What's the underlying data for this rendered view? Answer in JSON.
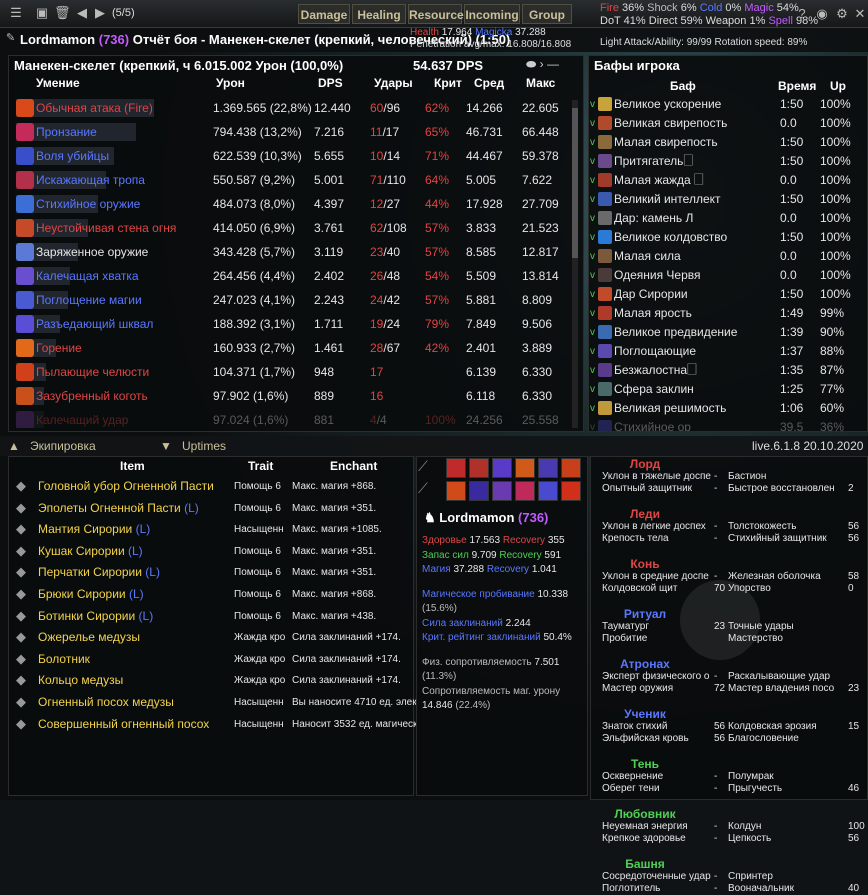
{
  "colors": {
    "gold": "#c9c09a",
    "red": "#e04545",
    "blue": "#5a78ff",
    "purple": "#c25cff",
    "yellow": "#f3d34a",
    "green": "#4fcf53"
  },
  "top": {
    "counter": "(5/5)",
    "tabs": [
      "Damage",
      "Healing",
      "Resource",
      "Incoming",
      "Group"
    ],
    "stats_l1": [
      {
        "k": "Fire",
        "v": "36%"
      },
      {
        "k": "Shock",
        "v": "6%"
      },
      {
        "k": "Cold",
        "v": "0%"
      },
      {
        "k": "Magic",
        "v": "54%"
      }
    ],
    "stats_l2": [
      {
        "k": "DoT",
        "v": "41%"
      },
      {
        "k": "Direct",
        "v": "59%"
      },
      {
        "k": "Weapon",
        "v": "1%"
      },
      {
        "k": "Spell",
        "v": "98%"
      }
    ],
    "stats_l3": "Light Attack/Ability: 99/99  Rotation speed: 89%"
  },
  "header": {
    "player": "Lordmamon",
    "level": "(736)",
    "title_rest": "Отчёт боя - Манекен-скелет (крепкий, человеческий) (1:50)",
    "health_label": "Health",
    "health": "17.964",
    "magicka_label": "Magicka",
    "magicka": "37.288",
    "penetration": "Penetration avg/max: 16.808/16.808"
  },
  "damage": {
    "target": "Манекен-скелет (крепкий, ч 6.015.002 Урон (100,0%)",
    "dps": "54.637 DPS",
    "cols": [
      "Умение",
      "Урон",
      "DPS",
      "Удары",
      "Крит",
      "Сред",
      "Макс"
    ],
    "rows": [
      {
        "n": "Обычная атака (Fire)",
        "nc": "red",
        "u": "1.369.565 (22,8%)",
        "d": "12.440",
        "h1": "60",
        "h2": "/96",
        "cr": "62%",
        "av": "14.266",
        "mx": "22.605",
        "bw": 138,
        "ic": "#d94a1a"
      },
      {
        "n": "Пронзание",
        "nc": "blue",
        "u": "794.438 (13,2%)",
        "d": "7.216",
        "h1": "11",
        "h2": "/17",
        "cr": "65%",
        "av": "46.731",
        "mx": "66.448",
        "bw": 120,
        "ic": "#c42a5a"
      },
      {
        "n": "Воля убийцы",
        "nc": "blue",
        "u": "622.539 (10,3%)",
        "d": "5.655",
        "h1": "10",
        "h2": "/14",
        "cr": "71%",
        "av": "44.467",
        "mx": "59.378",
        "bw": 98,
        "ic": "#3a4ec9"
      },
      {
        "n": "Искажающая тропа",
        "nc": "blue",
        "u": "550.587 (9,2%)",
        "d": "5.001",
        "h1": "71",
        "h2": "/110",
        "cr": "64%",
        "av": "5.005",
        "mx": "7.622",
        "bw": 90,
        "ic": "#b2304a"
      },
      {
        "n": "Стихийное оружие",
        "nc": "blue",
        "u": "484.073 (8,0%)",
        "d": "4.397",
        "h1": "12",
        "h2": "/27",
        "cr": "44%",
        "av": "17.928",
        "mx": "27.709",
        "bw": 82,
        "ic": "#3b6fd6"
      },
      {
        "n": "Неустойчивая стена огня",
        "nc": "red",
        "u": "414.050 (6,9%)",
        "d": "3.761",
        "h1": "62",
        "h2": "/108",
        "cr": "57%",
        "av": "3.833",
        "mx": "21.523",
        "bw": 72,
        "ic": "#c44a2a"
      },
      {
        "n": "Заряженное оружие",
        "nc": "white",
        "u": "343.428 (5,7%)",
        "d": "3.119",
        "h1": "23",
        "h2": "/40",
        "cr": "57%",
        "av": "8.585",
        "mx": "12.817",
        "bw": 62,
        "ic": "#5a7ad6"
      },
      {
        "n": "Калечащая хватка",
        "nc": "blue",
        "u": "264.456 (4,4%)",
        "d": "2.402",
        "h1": "26",
        "h2": "/48",
        "cr": "54%",
        "av": "5.509",
        "mx": "13.814",
        "bw": 54,
        "ic": "#6a4ed0"
      },
      {
        "n": "Поглощение магии",
        "nc": "blue",
        "u": "247.023 (4,1%)",
        "d": "2.243",
        "h1": "24",
        "h2": "/42",
        "cr": "57%",
        "av": "5.881",
        "mx": "8.809",
        "bw": 52,
        "ic": "#4a5ad0"
      },
      {
        "n": "Разъедающий шквал",
        "nc": "blue",
        "u": "188.392 (3,1%)",
        "d": "1.711",
        "h1": "19",
        "h2": "/24",
        "cr": "79%",
        "av": "7.849",
        "mx": "9.506",
        "bw": 44,
        "ic": "#5a4ed6"
      },
      {
        "n": "Горение",
        "nc": "red",
        "u": "160.933 (2,7%)",
        "d": "1.461",
        "h1": "28",
        "h2": "/67",
        "cr": "42%",
        "av": "2.401",
        "mx": "3.889",
        "bw": 40,
        "ic": "#e06a1a"
      },
      {
        "n": "Пылающие челюсти",
        "nc": "red",
        "u": "104.371 (1,7%)",
        "d": "948",
        "h1": "17",
        "h2": "",
        "cr": "",
        "av": "6.139",
        "mx": "6.330",
        "bw": 30,
        "ic": "#d0401a"
      },
      {
        "n": "Зазубренный коготь",
        "nc": "red",
        "u": "97.902 (1,6%)",
        "d": "889",
        "h1": "16",
        "h2": "",
        "cr": "",
        "av": "6.118",
        "mx": "6.330",
        "bw": 28,
        "ic": "#c8501a"
      },
      {
        "n": "Калечащий удар",
        "nc": "red",
        "u": "97.024 (1,6%)",
        "d": "881",
        "h1": "4",
        "h2": "/4",
        "cr": "100%",
        "av": "24.256",
        "mx": "25.558",
        "bw": 28,
        "ic": "#7a3aa0"
      }
    ]
  },
  "buffs": {
    "title": "Бафы игрока",
    "cols": [
      "Баф",
      "Время",
      "Up"
    ],
    "rows": [
      {
        "n": "Великое ускорение",
        "t": "1:50",
        "u": "100%",
        "ic": "#c8a23a"
      },
      {
        "n": "Великая свирепость",
        "t": "0.0",
        "u": "100%",
        "ic": "#b04a2a"
      },
      {
        "n": "Малая свирепость",
        "t": "1:50",
        "u": "100%",
        "ic": "#8a6a3a"
      },
      {
        "n": "Притягатель🗌",
        "t": "1:50",
        "u": "100%",
        "ic": "#6a4a8a"
      },
      {
        "n": "Малая жажда 🗌",
        "t": "0.0",
        "u": "100%",
        "ic": "#a03a2a"
      },
      {
        "n": "Великий интеллект",
        "t": "1:50",
        "u": "100%",
        "ic": "#3a5ab0"
      },
      {
        "n": "Дар: камень Л",
        "t": "0.0",
        "u": "100%",
        "ic": "#6a6a6a"
      },
      {
        "n": "Великое колдовство",
        "t": "1:50",
        "u": "100%",
        "ic": "#2a7ad6"
      },
      {
        "n": "Малая сила",
        "t": "0.0",
        "u": "100%",
        "ic": "#7a5a3a"
      },
      {
        "n": "Одеяния Червя",
        "t": "0.0",
        "u": "100%",
        "ic": "#4a3a3a"
      },
      {
        "n": "Дар Сирории",
        "t": "1:50",
        "u": "100%",
        "ic": "#c04a2a"
      },
      {
        "n": "Малая ярость",
        "t": "1:49",
        "u": "99%",
        "ic": "#b03a2a"
      },
      {
        "n": "Великое предвидение",
        "t": "1:39",
        "u": "90%",
        "ic": "#3a6ab0"
      },
      {
        "n": "Поглощающие",
        "t": "1:37",
        "u": "88%",
        "ic": "#5a4ab0"
      },
      {
        "n": "Безжалостна🗌",
        "t": "1:35",
        "u": "87%",
        "ic": "#5a3a8a"
      },
      {
        "n": "Сфера заклин",
        "t": "1:25",
        "u": "77%",
        "ic": "#4a6a6a"
      },
      {
        "n": "Великая решимость",
        "t": "1:06",
        "u": "60%",
        "ic": "#c09a3a"
      },
      {
        "n": "Стихийное ор",
        "t": "39.5",
        "u": "36%",
        "ic": "#4a4ad0"
      }
    ]
  },
  "mid": {
    "equip_label": "Экипировка",
    "uptimes_label": "Uptimes",
    "version": "live.6.1.8 20.10.2020"
  },
  "equip": {
    "cols": [
      "Item",
      "Trait",
      "Enchant"
    ],
    "rows": [
      {
        "n": "Головной убор Огненной Пасти",
        "l": "",
        "t": "Помощь 6",
        "e": "Макс. магия +868."
      },
      {
        "n": "Эполеты Огненной Пасти",
        "l": "(L)",
        "t": "Помощь 6",
        "e": "Макс. магия +351."
      },
      {
        "n": "Мантия Сирории",
        "l": "(L)",
        "t": "Насыщенн",
        "e": "Макс. магия +1085."
      },
      {
        "n": "Кушак Сирории",
        "l": "(L)",
        "t": "Помощь 6",
        "e": "Макс. магия +351."
      },
      {
        "n": "Перчатки Сирории",
        "l": "(L)",
        "t": "Помощь 6",
        "e": "Макс. магия +351."
      },
      {
        "n": "Брюки Сирории",
        "l": "(L)",
        "t": "Помощь 6",
        "e": "Макс. магия +868."
      },
      {
        "n": "Ботинки Сирории",
        "l": "(L)",
        "t": "Помощь 6",
        "e": "Макс. магия +438."
      },
      {
        "n": "Ожерелье медузы",
        "l": "",
        "t": "Жажда кро",
        "e": "Сила заклинаний +174."
      },
      {
        "n": "Болотник",
        "l": "",
        "t": "Жажда кро",
        "e": "Сила заклинаний +174."
      },
      {
        "n": "Кольцо медузы",
        "l": "",
        "t": "Жажда кро",
        "e": "Сила заклинаний +174."
      },
      {
        "n": "Огненный посох медузы",
        "l": "",
        "t": "Насыщенн",
        "e": "Вы наносите 4710 ед. элек"
      },
      {
        "n": "Совершенный огненный посох",
        "l": "",
        "t": "Насыщенн",
        "e": "Наносит 3532 ед. магическ"
      }
    ]
  },
  "char": {
    "name": "Lordmamon",
    "level": "(736)",
    "l1": {
      "a": "Здоровье",
      "b": "17.563",
      "c": "Recovery",
      "d": "355"
    },
    "l2": {
      "a": "Запас сил",
      "b": "9.709",
      "c": "Recovery",
      "d": "591"
    },
    "l3": {
      "a": "Магия",
      "b": "37.288",
      "c": "Recovery",
      "d": "1.041"
    },
    "p1": "Магическое пробивание",
    "p1v": "10.338",
    "p1p": "(15.6%)",
    "p2": "Сила заклинаний",
    "p2v": "2.244",
    "p3": "Крит. рейтинг заклинаний",
    "p3v": "50.4%",
    "r1": "Физ. сопротивляемость",
    "r1v": "7.501",
    "r1p": "(11.3%)",
    "r2": "Сопротивляемость маг. урону",
    "r2v": "14.846",
    "r2p": "(22.4%)"
  },
  "cp": [
    {
      "h": "Лорд",
      "hc": "#e04545",
      "rows": [
        [
          "Уклон в тяжелые доспе",
          "-",
          "Бастион",
          ""
        ],
        [
          "Опытный защитник",
          "-",
          "Быстрое восстановлен",
          "2"
        ]
      ]
    },
    {
      "h": "Леди",
      "hc": "#e04545",
      "rows": [
        [
          "Уклон в легкие доспех",
          "-",
          "Толстокожесть",
          "56"
        ],
        [
          "Крепость тела",
          "-",
          "Стихийный защитник",
          "56"
        ]
      ]
    },
    {
      "h": "Конь",
      "hc": "#e04545",
      "rows": [
        [
          "Уклон в средние доспе",
          "-",
          "Железная оболочка",
          "58"
        ],
        [
          "Колдовской щит",
          "70",
          "Упорство",
          "0"
        ]
      ]
    },
    {
      "h": "Ритуал",
      "hc": "#5a78ff",
      "rows": [
        [
          "Тауматург",
          "23",
          "Точные удары",
          ""
        ],
        [
          "Пробитие",
          "",
          "Мастерство",
          ""
        ]
      ]
    },
    {
      "h": "Атронах",
      "hc": "#5a78ff",
      "rows": [
        [
          "Эксперт физического о",
          "-",
          "Раскалывающие удар",
          ""
        ],
        [
          "Мастер оружия",
          "72",
          "Мастер владения посо",
          "23"
        ]
      ]
    },
    {
      "h": "Ученик",
      "hc": "#5a78ff",
      "rows": [
        [
          "Знаток стихий",
          "56",
          "Колдовская эрозия",
          "15"
        ],
        [
          "Эльфийская кровь",
          "56",
          "Благословение",
          ""
        ]
      ]
    },
    {
      "h": "Тень",
      "hc": "#4fcf53",
      "rows": [
        [
          "Осквернение",
          "-",
          "Полумрак",
          ""
        ],
        [
          "Оберег тени",
          "-",
          "Прыгучесть",
          "46"
        ]
      ]
    },
    {
      "h": "Любовник",
      "hc": "#4fcf53",
      "rows": [
        [
          "Неуемная энергия",
          "-",
          "Колдун",
          "100"
        ],
        [
          "Крепкое здоровье",
          "-",
          "Цепкость",
          "56"
        ]
      ]
    },
    {
      "h": "Башня",
      "hc": "#4fcf53",
      "rows": [
        [
          "Сосредоточенные удар",
          "-",
          "Спринтер",
          ""
        ],
        [
          "Поглотитель",
          "-",
          "Вооначальник",
          "40"
        ]
      ]
    }
  ]
}
